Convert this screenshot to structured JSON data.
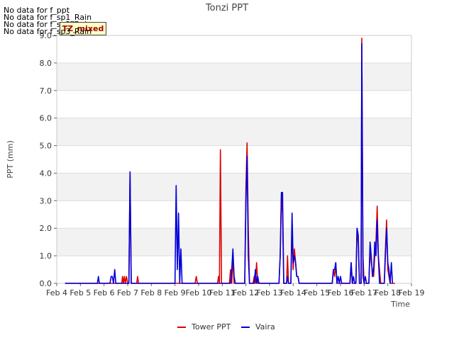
{
  "notices": [
    "No data for f_ppt",
    "No data for f_sp1_Rain",
    "No data for f_sp2_Rain",
    "No data for f_sp3_Rain"
  ],
  "badge_label": "TZ_mixed",
  "chart_data": {
    "type": "line",
    "title": "Tonzi PPT",
    "xlabel": "Time",
    "ylabel": "PPT (mm)",
    "xlim": [
      4,
      19
    ],
    "ylim": [
      0,
      9
    ],
    "x_ticks": [
      4,
      5,
      6,
      7,
      8,
      9,
      10,
      11,
      12,
      13,
      14,
      15,
      16,
      17,
      18,
      19
    ],
    "x_tick_labels": [
      "Feb 4",
      "Feb 5",
      "Feb 6",
      "Feb 7",
      "Feb 8",
      "Feb 9",
      "Feb 10",
      "Feb 11",
      "Feb 12",
      "Feb 13",
      "Feb 14",
      "Feb 15",
      "Feb 16",
      "Feb 17",
      "Feb 18",
      "Feb 19"
    ],
    "y_ticks": [
      0,
      1,
      2,
      3,
      4,
      5,
      6,
      7,
      8,
      9
    ],
    "y_tick_labels": [
      "0.0",
      "1.0",
      "2.0",
      "3.0",
      "4.0",
      "5.0",
      "6.0",
      "7.0",
      "8.0",
      "9.0"
    ],
    "grid": true,
    "legend_position": "bottom-center",
    "series": [
      {
        "name": "Tower PPT",
        "color": "#dd0000",
        "points": [
          [
            4.35,
            0
          ],
          [
            6.75,
            0
          ],
          [
            6.78,
            0.25
          ],
          [
            6.82,
            0
          ],
          [
            6.86,
            0.25
          ],
          [
            6.9,
            0
          ],
          [
            6.95,
            0.25
          ],
          [
            7.0,
            0
          ],
          [
            7.05,
            0
          ],
          [
            7.1,
            4.0
          ],
          [
            7.15,
            0
          ],
          [
            7.38,
            0
          ],
          [
            7.42,
            0.25
          ],
          [
            7.46,
            0
          ],
          [
            9.85,
            0
          ],
          [
            9.9,
            0.25
          ],
          [
            9.95,
            0
          ],
          [
            10.8,
            0
          ],
          [
            10.84,
            0.25
          ],
          [
            10.88,
            0
          ],
          [
            10.92,
            4.85
          ],
          [
            10.97,
            0
          ],
          [
            11.3,
            0
          ],
          [
            11.35,
            0.5
          ],
          [
            11.4,
            0
          ],
          [
            11.45,
            1.0
          ],
          [
            11.5,
            0
          ],
          [
            11.95,
            0
          ],
          [
            12.0,
            3.5
          ],
          [
            12.05,
            5.1
          ],
          [
            12.1,
            2.0
          ],
          [
            12.15,
            0
          ],
          [
            12.3,
            0
          ],
          [
            12.35,
            0.25
          ],
          [
            12.4,
            0
          ],
          [
            12.45,
            0.75
          ],
          [
            12.5,
            0
          ],
          [
            13.4,
            0
          ],
          [
            13.45,
            1.0
          ],
          [
            13.5,
            3.25
          ],
          [
            13.55,
            2.5
          ],
          [
            13.6,
            0
          ],
          [
            13.72,
            0
          ],
          [
            13.76,
            1.0
          ],
          [
            13.8,
            0
          ],
          [
            13.9,
            0
          ],
          [
            13.95,
            2.0
          ],
          [
            14.0,
            0.5
          ],
          [
            14.05,
            1.25
          ],
          [
            14.1,
            0.75
          ],
          [
            14.15,
            0.25
          ],
          [
            14.2,
            0.25
          ],
          [
            14.25,
            0
          ],
          [
            15.65,
            0
          ],
          [
            15.7,
            0.5
          ],
          [
            15.75,
            0.25
          ],
          [
            15.8,
            0.75
          ],
          [
            15.85,
            0
          ],
          [
            16.4,
            0
          ],
          [
            16.45,
            0.75
          ],
          [
            16.5,
            0
          ],
          [
            16.65,
            0
          ],
          [
            16.7,
            2.0
          ],
          [
            16.75,
            1.5
          ],
          [
            16.8,
            0
          ],
          [
            16.87,
            0
          ],
          [
            16.9,
            8.9
          ],
          [
            16.95,
            1.0
          ],
          [
            17.0,
            0
          ],
          [
            17.2,
            0
          ],
          [
            17.25,
            1.25
          ],
          [
            17.3,
            0.75
          ],
          [
            17.35,
            0.5
          ],
          [
            17.4,
            0.25
          ],
          [
            17.45,
            1.0
          ],
          [
            17.5,
            1.5
          ],
          [
            17.55,
            2.8
          ],
          [
            17.6,
            1.0
          ],
          [
            17.65,
            0.5
          ],
          [
            17.7,
            0
          ],
          [
            17.85,
            0
          ],
          [
            17.9,
            1.25
          ],
          [
            17.95,
            2.3
          ],
          [
            18.0,
            0.5
          ],
          [
            18.05,
            0.25
          ],
          [
            18.1,
            0
          ],
          [
            18.3,
            0
          ]
        ]
      },
      {
        "name": "Vaira",
        "color": "#0000dd",
        "points": [
          [
            4.35,
            0
          ],
          [
            5.72,
            0
          ],
          [
            5.76,
            0.25
          ],
          [
            5.8,
            0
          ],
          [
            6.25,
            0
          ],
          [
            6.3,
            0.25
          ],
          [
            6.35,
            0.25
          ],
          [
            6.4,
            0
          ],
          [
            6.45,
            0.5
          ],
          [
            6.5,
            0
          ],
          [
            7.05,
            0
          ],
          [
            7.1,
            4.05
          ],
          [
            7.15,
            0
          ],
          [
            9.0,
            0
          ],
          [
            9.05,
            3.55
          ],
          [
            9.1,
            0.5
          ],
          [
            9.15,
            2.55
          ],
          [
            9.2,
            0
          ],
          [
            9.25,
            1.25
          ],
          [
            9.3,
            0
          ],
          [
            11.35,
            0
          ],
          [
            11.4,
            0.5
          ],
          [
            11.45,
            1.25
          ],
          [
            11.5,
            0.25
          ],
          [
            11.55,
            0
          ],
          [
            11.95,
            0
          ],
          [
            12.0,
            3.0
          ],
          [
            12.05,
            4.6
          ],
          [
            12.1,
            1.0
          ],
          [
            12.15,
            0
          ],
          [
            12.35,
            0
          ],
          [
            12.4,
            0.5
          ],
          [
            12.45,
            0
          ],
          [
            12.5,
            0.25
          ],
          [
            12.55,
            0
          ],
          [
            13.4,
            0
          ],
          [
            13.45,
            1.0
          ],
          [
            13.5,
            3.3
          ],
          [
            13.55,
            3.3
          ],
          [
            13.6,
            0
          ],
          [
            13.72,
            0
          ],
          [
            13.76,
            0.25
          ],
          [
            13.8,
            0
          ],
          [
            13.9,
            0
          ],
          [
            13.95,
            2.55
          ],
          [
            14.0,
            0.75
          ],
          [
            14.05,
            1.0
          ],
          [
            14.1,
            0.75
          ],
          [
            14.15,
            0.25
          ],
          [
            14.2,
            0.25
          ],
          [
            14.25,
            0
          ],
          [
            15.65,
            0
          ],
          [
            15.7,
            0.5
          ],
          [
            15.75,
            0.5
          ],
          [
            15.8,
            0.75
          ],
          [
            15.85,
            0
          ],
          [
            15.9,
            0.25
          ],
          [
            15.95,
            0
          ],
          [
            16.0,
            0.25
          ],
          [
            16.05,
            0
          ],
          [
            16.4,
            0
          ],
          [
            16.45,
            0.75
          ],
          [
            16.5,
            0
          ],
          [
            16.55,
            0.25
          ],
          [
            16.6,
            0
          ],
          [
            16.65,
            0
          ],
          [
            16.7,
            2.0
          ],
          [
            16.75,
            1.75
          ],
          [
            16.8,
            0
          ],
          [
            16.87,
            0
          ],
          [
            16.9,
            8.7
          ],
          [
            16.95,
            0.25
          ],
          [
            17.0,
            0
          ],
          [
            17.05,
            0.25
          ],
          [
            17.1,
            0
          ],
          [
            17.2,
            0
          ],
          [
            17.25,
            1.5
          ],
          [
            17.3,
            1.0
          ],
          [
            17.35,
            0.25
          ],
          [
            17.4,
            0.5
          ],
          [
            17.45,
            1.5
          ],
          [
            17.5,
            1.0
          ],
          [
            17.55,
            2.3
          ],
          [
            17.6,
            1.0
          ],
          [
            17.65,
            0
          ],
          [
            17.85,
            0
          ],
          [
            17.9,
            1.0
          ],
          [
            17.95,
            2.0
          ],
          [
            18.0,
            0.75
          ],
          [
            18.05,
            0.5
          ],
          [
            18.1,
            0
          ],
          [
            18.15,
            0.75
          ],
          [
            18.2,
            0
          ]
        ]
      }
    ]
  }
}
